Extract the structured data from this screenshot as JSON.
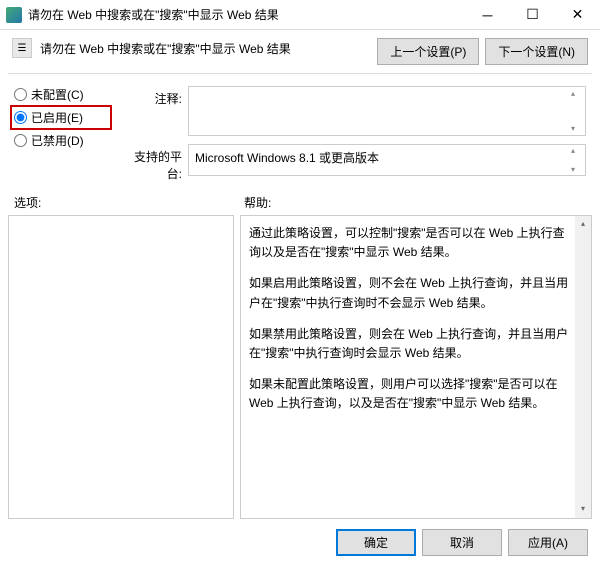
{
  "window": {
    "title": "请勿在 Web 中搜索或在\"搜索\"中显示 Web 结果"
  },
  "header": {
    "title": "请勿在 Web 中搜索或在\"搜索\"中显示 Web 结果",
    "prev": "上一个设置(P)",
    "next": "下一个设置(N)"
  },
  "radios": {
    "not_configured": "未配置(C)",
    "enabled": "已启用(E)",
    "disabled": "已禁用(D)"
  },
  "labels": {
    "comment": "注释:",
    "platform": "支持的平台:",
    "options": "选项:",
    "help": "帮助:"
  },
  "platform_text": "Microsoft Windows 8.1 或更高版本",
  "help": {
    "p1": "通过此策略设置，可以控制\"搜索\"是否可以在 Web 上执行查询以及是否在\"搜索\"中显示 Web 结果。",
    "p2": "如果启用此策略设置，则不会在 Web 上执行查询，并且当用户在\"搜索\"中执行查询时不会显示 Web 结果。",
    "p3": "如果禁用此策略设置，则会在 Web 上执行查询，并且当用户在\"搜索\"中执行查询时会显示 Web 结果。",
    "p4": "如果未配置此策略设置，则用户可以选择\"搜索\"是否可以在 Web 上执行查询，以及是否在\"搜索\"中显示 Web 结果。"
  },
  "buttons": {
    "ok": "确定",
    "cancel": "取消",
    "apply": "应用(A)"
  }
}
